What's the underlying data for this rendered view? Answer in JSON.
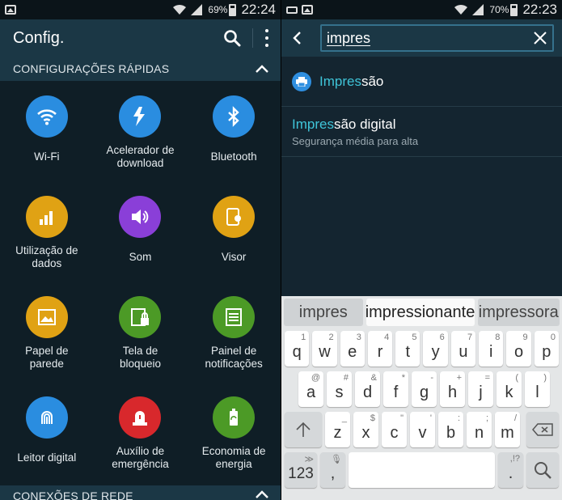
{
  "left": {
    "status": {
      "battery": "69%",
      "time": "22:24"
    },
    "title": "Config.",
    "quick_section": "CONFIGURAÇÕES RÁPIDAS",
    "tiles": [
      {
        "label": "Wi-Fi",
        "icon": "wifi-icon",
        "color": "#2a8de0"
      },
      {
        "label": "Acelerador de\ndownload",
        "icon": "download-booster-icon",
        "color": "#2a8de0"
      },
      {
        "label": "Bluetooth",
        "icon": "bluetooth-icon",
        "color": "#2a8de0"
      },
      {
        "label": "Utilização de\ndados",
        "icon": "data-usage-icon",
        "color": "#e0a214"
      },
      {
        "label": "Som",
        "icon": "sound-icon",
        "color": "#8a3fd8"
      },
      {
        "label": "Visor",
        "icon": "display-icon",
        "color": "#e0a214"
      },
      {
        "label": "Papel de\nparede",
        "icon": "wallpaper-icon",
        "color": "#e0a214"
      },
      {
        "label": "Tela de\nbloqueio",
        "icon": "lock-screen-icon",
        "color": "#4c9a26"
      },
      {
        "label": "Painel de\nnotificações",
        "icon": "notification-panel-icon",
        "color": "#4c9a26"
      },
      {
        "label": "Leitor digital",
        "icon": "fingerprint-icon",
        "color": "#2a8de0"
      },
      {
        "label": "Auxílio de\nemergência",
        "icon": "emergency-icon",
        "color": "#d8282c"
      },
      {
        "label": "Economia de\nenergia",
        "icon": "power-saving-icon",
        "color": "#4c9a26"
      }
    ],
    "bottom_section": "CONEXÕES DE REDE"
  },
  "right": {
    "status": {
      "battery": "70%",
      "time": "22:23"
    },
    "search_value": "impres",
    "results": [
      {
        "match": "Impres",
        "rest": "são"
      },
      {
        "match": "Impres",
        "rest": "são digital",
        "sub": "Segurança média para alta"
      }
    ],
    "keyboard": {
      "suggestions": [
        "impres",
        "impressionante",
        "impressora"
      ],
      "row1": [
        [
          "q",
          "1"
        ],
        [
          "w",
          "2"
        ],
        [
          "e",
          "3"
        ],
        [
          "r",
          "4"
        ],
        [
          "t",
          "5"
        ],
        [
          "y",
          "6"
        ],
        [
          "u",
          "7"
        ],
        [
          "i",
          "8"
        ],
        [
          "o",
          "9"
        ],
        [
          "p",
          "0"
        ]
      ],
      "row2": [
        [
          "a",
          "@"
        ],
        [
          "s",
          "#"
        ],
        [
          "d",
          "&"
        ],
        [
          "f",
          "*"
        ],
        [
          "g",
          "-"
        ],
        [
          "h",
          "+"
        ],
        [
          "j",
          "="
        ],
        [
          "k",
          "("
        ],
        [
          "l",
          ")"
        ]
      ],
      "row3": [
        [
          "z",
          "_"
        ],
        [
          "x",
          "$"
        ],
        [
          "c",
          "\""
        ],
        [
          "v",
          "'"
        ],
        [
          "b",
          ":"
        ],
        [
          "n",
          ";"
        ],
        [
          "m",
          "/"
        ]
      ],
      "num_label": "123",
      "comma": ",",
      "period": ".",
      "period_sup": ",!?"
    }
  }
}
